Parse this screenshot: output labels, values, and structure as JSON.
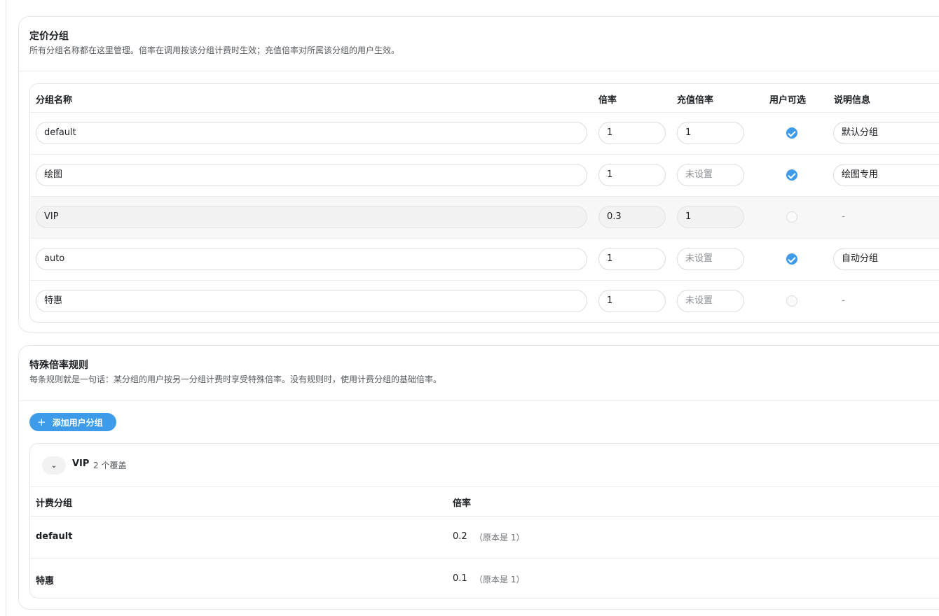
{
  "pricing": {
    "title": "定价分组",
    "description": "所有分组名称都在这里管理。倍率在调用按该分组计费时生效；充值倍率对所属该分组的用户生效。",
    "columns": [
      "分组名称",
      "倍率",
      "充值倍率",
      "用户可选",
      "说明信息"
    ],
    "rows": [
      {
        "name": "default",
        "rate": "1",
        "charge_rate": "1",
        "charge_placeholder": "",
        "selectable": true,
        "desc": "默认分组",
        "disabled": false
      },
      {
        "name": "绘图",
        "rate": "1",
        "charge_rate": "",
        "charge_placeholder": "未设置",
        "selectable": true,
        "desc": "绘图专用",
        "disabled": false
      },
      {
        "name": "VIP",
        "rate": "0.3",
        "charge_rate": "1",
        "charge_placeholder": "",
        "selectable": false,
        "desc": "-",
        "disabled": true
      },
      {
        "name": "auto",
        "rate": "1",
        "charge_rate": "",
        "charge_placeholder": "未设置",
        "selectable": true,
        "desc": "自动分组",
        "disabled": false
      },
      {
        "name": "特惠",
        "rate": "1",
        "charge_rate": "",
        "charge_placeholder": "未设置",
        "selectable": false,
        "desc": "-",
        "disabled": false
      }
    ]
  },
  "special": {
    "title": "特殊倍率规则",
    "description": "每条规则就是一句话：某分组的用户按另一分组计费时享受特殊倍率。没有规则时，使用计费分组的基础倍率。",
    "add_button": "添加用户分组",
    "add_icon": "plus-icon",
    "group": {
      "name": "VIP",
      "count": "2 个覆盖",
      "toggle_icon": "chevron-down-icon",
      "columns": [
        "计费分组",
        "倍率"
      ],
      "rules": [
        {
          "billing_group": "default",
          "rate": "0.2",
          "original": "（原本是 1）"
        },
        {
          "billing_group": "特惠",
          "rate": "0.1",
          "original": "（原本是 1）"
        }
      ]
    }
  },
  "colors": {
    "accent": "#3d9bea",
    "border": "#e6e6e6",
    "muted_text": "#55595e"
  }
}
